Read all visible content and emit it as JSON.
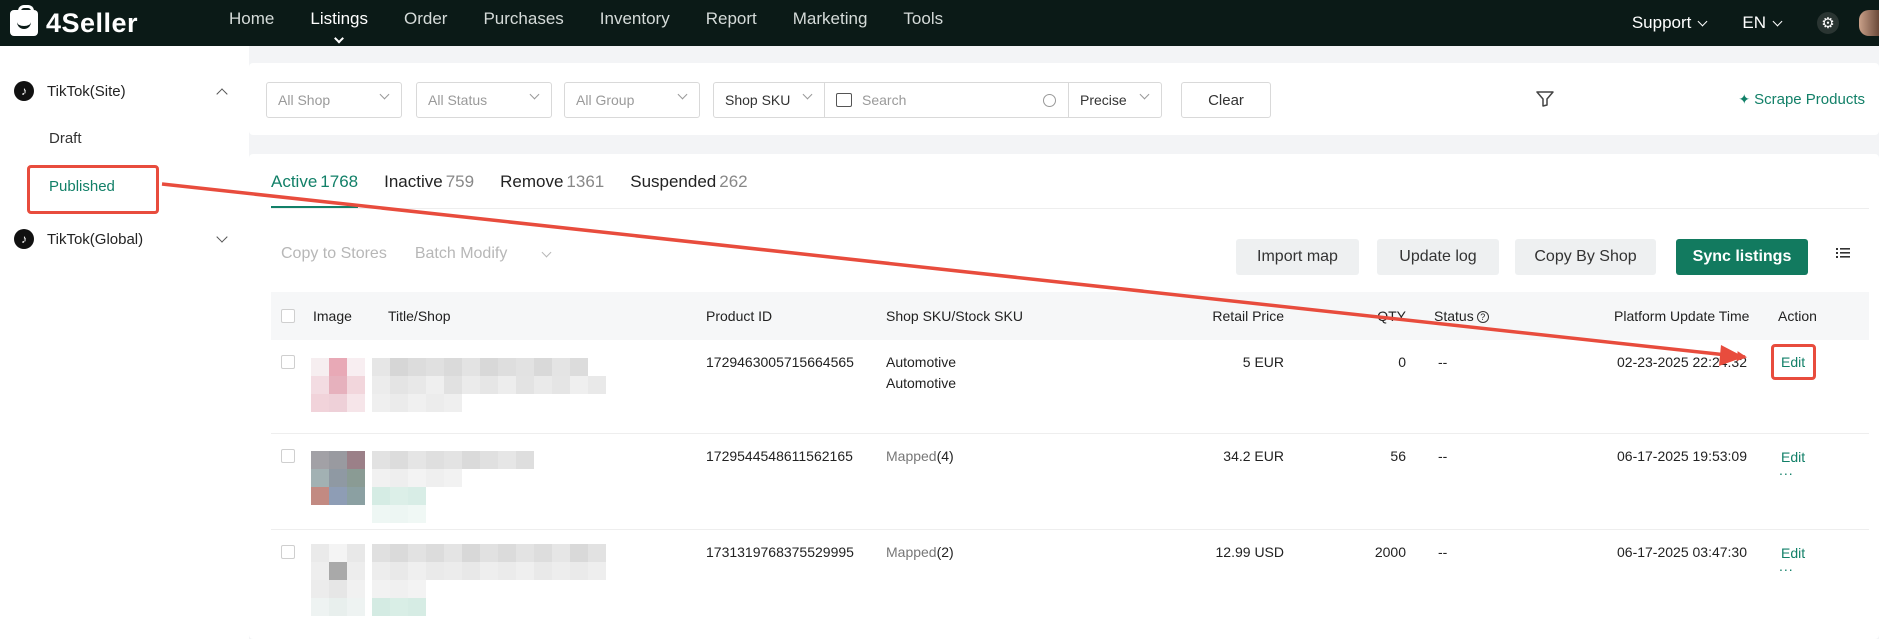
{
  "app": {
    "logo_text": "4Seller"
  },
  "nav": {
    "items": [
      "Home",
      "Listings",
      "Order",
      "Purchases",
      "Inventory",
      "Report",
      "Marketing",
      "Tools"
    ],
    "active": "Listings",
    "support": "Support",
    "language": "EN"
  },
  "sidebar": {
    "site": {
      "label": "TikTok(Site)",
      "children": [
        "Draft",
        "Published"
      ]
    },
    "global": {
      "label": "TikTok(Global)"
    },
    "active_child": "Published"
  },
  "filters": {
    "shop": "All Shop",
    "status": "All Status",
    "group": "All Group",
    "search_type": "Shop SKU",
    "search_placeholder": "Search",
    "match": "Precise",
    "clear": "Clear",
    "scrape": "Scrape Products"
  },
  "tabs": [
    {
      "label": "Active",
      "count": "1768"
    },
    {
      "label": "Inactive",
      "count": "759"
    },
    {
      "label": "Remove",
      "count": "1361"
    },
    {
      "label": "Suspended",
      "count": "262"
    }
  ],
  "toolbar": {
    "copy_to_stores": "Copy to Stores",
    "batch_modify": "Batch Modify",
    "import_map": "Import map",
    "update_log": "Update log",
    "copy_by_shop": "Copy By Shop",
    "sync_listings": "Sync listings"
  },
  "table": {
    "headers": {
      "image": "Image",
      "title": "Title/Shop",
      "product_id": "Product ID",
      "sku": "Shop SKU/Stock SKU",
      "price": "Retail Price",
      "qty": "QTY",
      "status": "Status",
      "updated": "Platform Update Time",
      "action": "Action"
    },
    "rows": [
      {
        "product_id": "1729463005715664565",
        "sku_line1": "Automotive",
        "sku_line2": "Automotive",
        "price": "5 EUR",
        "qty": "0",
        "status": "--",
        "updated": "02-23-2025 22:24:32",
        "edit": "Edit",
        "more": "..."
      },
      {
        "product_id": "1729544548611562165",
        "sku_prefix": "Mapped",
        "sku_count": "(4)",
        "price": "34.2 EUR",
        "qty": "56",
        "status": "--",
        "updated": "06-17-2025 19:53:09",
        "edit": "Edit",
        "more": "..."
      },
      {
        "product_id": "1731319768375529995",
        "sku_prefix": "Mapped",
        "sku_count": "(2)",
        "price": "12.99 USD",
        "qty": "2000",
        "status": "--",
        "updated": "06-17-2025 03:47:30",
        "edit": "Edit",
        "more": "..."
      }
    ]
  },
  "colors": {
    "accent": "#128068",
    "annotation": "#e84c3d",
    "topbar": "#0b1a17"
  }
}
